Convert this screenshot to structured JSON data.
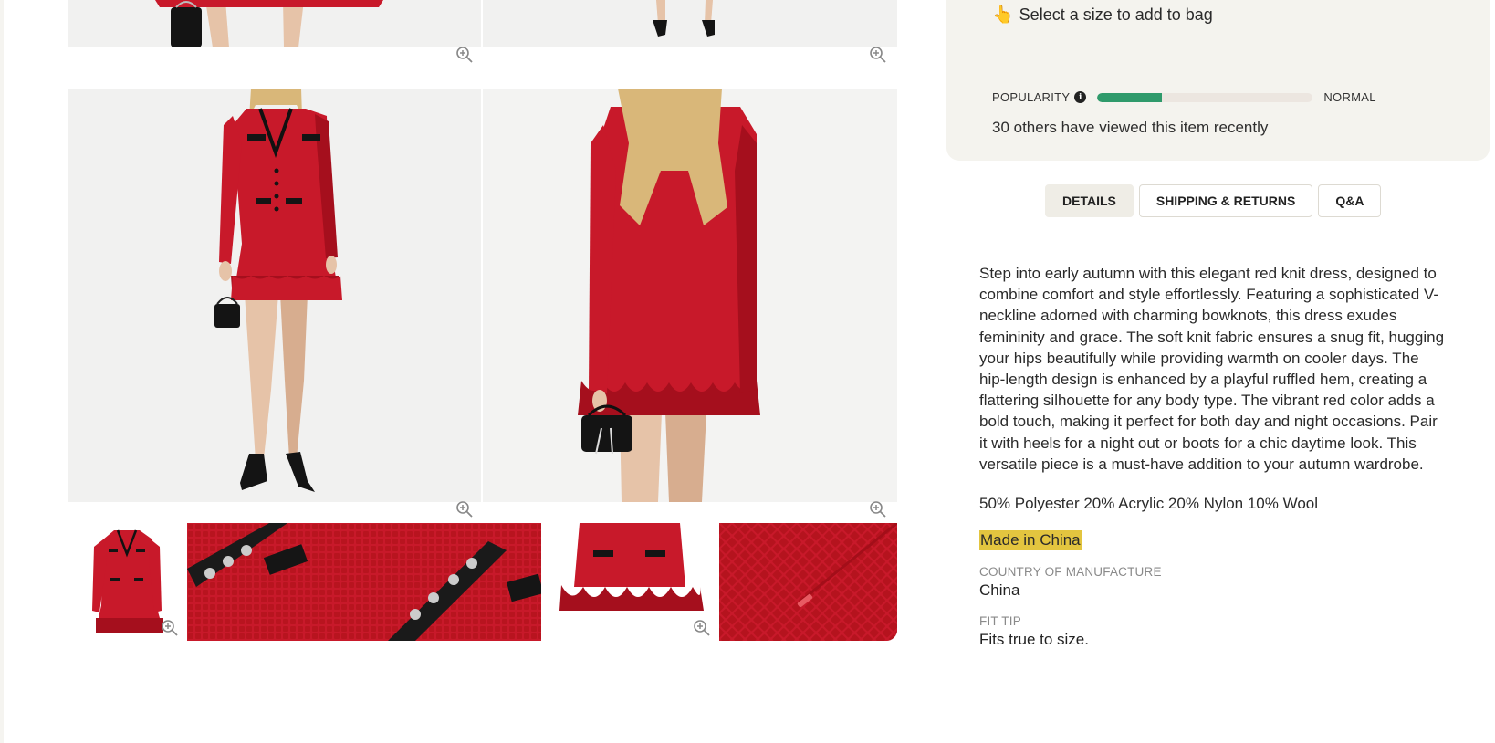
{
  "purchase": {
    "size_hint_icon": "pointing-hand-icon",
    "size_hint": "Select a size to add to bag"
  },
  "popularity": {
    "label": "POPULARITY",
    "info_icon": "info-icon",
    "level": "NORMAL",
    "fill_fraction": 0.3,
    "bar_color": "#2f9a6b",
    "viewed_text": "30 others have viewed this item recently"
  },
  "tabs": [
    {
      "label": "DETAILS",
      "active": true
    },
    {
      "label": "SHIPPING & RETURNS",
      "active": false
    },
    {
      "label": "Q&A",
      "active": false
    }
  ],
  "details": {
    "description": "Step into early autumn with this elegant red knit dress, designed to combine comfort and style effortlessly. Featuring a sophisticated V-neckline adorned with charming bowknots, this dress exudes femininity and grace. The soft knit fabric ensures a snug fit, hugging your hips beautifully while providing warmth on cooler days. The hip-length design is enhanced by a playful ruffled hem, creating a flattering silhouette for any body type. The vibrant red color adds a bold touch, making it perfect for both day and night occasions. Pair it with heels for a night out or boots for a chic daytime look. This versatile piece is a must-have addition to your autumn wardrobe.",
    "composition": "50% Polyester 20% Acrylic 20% Nylon 10% Wool",
    "made_in": "Made in China",
    "highlight_color": "#e3c53f",
    "country_label": "COUNTRY OF MANUFACTURE",
    "country_value": "China",
    "fit_label": "FIT TIP",
    "fit_value": "Fits true to size."
  },
  "gallery": {
    "zoom_icon": "zoom-in-icon",
    "product_color": "#c8192a"
  }
}
